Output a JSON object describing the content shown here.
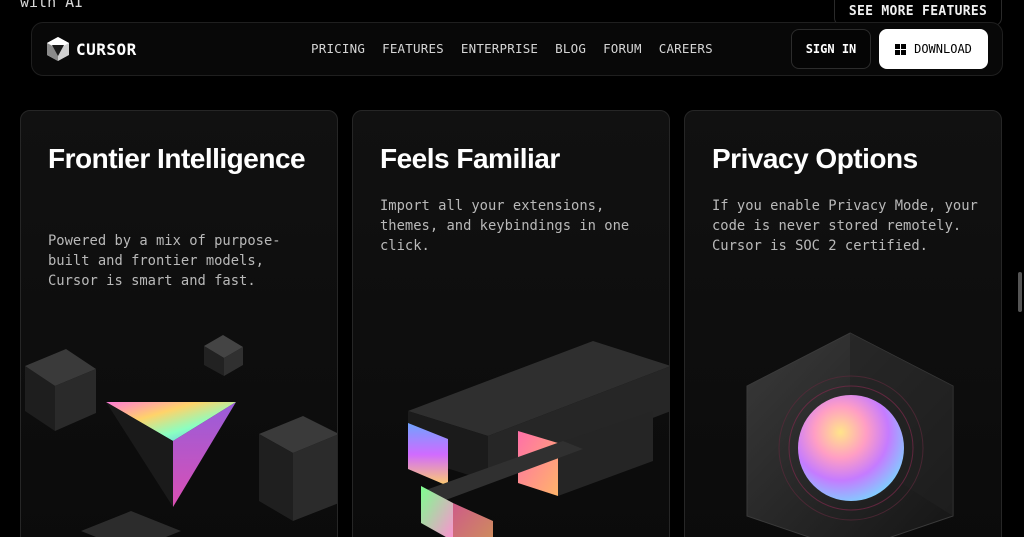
{
  "top_residue": {
    "text": "with AI",
    "see_more": "SEE MORE FEATURES"
  },
  "nav": {
    "logo_text": "CURSOR",
    "links": [
      "PRICING",
      "FEATURES",
      "ENTERPRISE",
      "BLOG",
      "FORUM",
      "CAREERS"
    ],
    "sign_in": "SIGN IN",
    "download": "DOWNLOAD"
  },
  "cards": [
    {
      "title": "Frontier Intelligence",
      "body": "Powered by a mix of purpose-built and frontier models, Cursor is smart and fast."
    },
    {
      "title": "Feels Familiar",
      "body": "Import all your extensions, themes, and keybindings in one click."
    },
    {
      "title": "Privacy Options",
      "body": "If you enable Privacy Mode, your code is never stored remotely. Cursor is SOC 2 certified."
    }
  ]
}
